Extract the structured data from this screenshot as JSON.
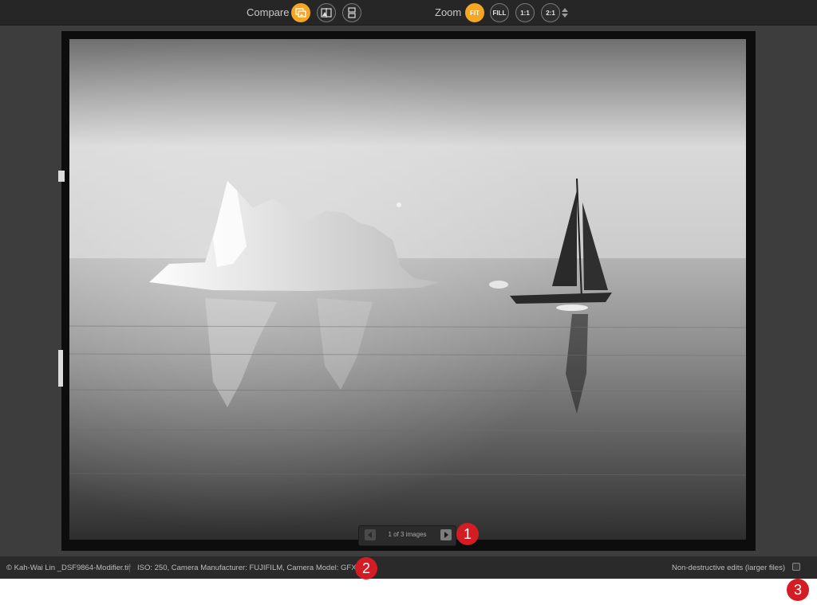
{
  "toolbar": {
    "compare_label": "Compare",
    "zoom_label": "Zoom",
    "compare_buttons": [
      {
        "icon": "compare-side-icon",
        "active": true
      },
      {
        "icon": "compare-split-icon",
        "active": false
      },
      {
        "icon": "compare-stack-icon",
        "active": false
      }
    ],
    "zoom_buttons": [
      {
        "label": "FIT",
        "active": true
      },
      {
        "label": "FILL",
        "active": false
      },
      {
        "label": "1:1",
        "active": false
      },
      {
        "label": "2:1",
        "active": false
      }
    ],
    "accent_color": "#f5a623"
  },
  "pager": {
    "text": "1 of 3 images",
    "prev_icon": "triangle-left-icon",
    "next_icon": "triangle-right-icon"
  },
  "status": {
    "file": "© Kah-Wai Lin _DSF9864-Modifier.tif",
    "meta": "ISO: 250, Camera Manufacturer: FUJIFILM, Camera Model: GFX 50R",
    "nondestructive_label": "Non-destructive edits (larger files)",
    "nondestructive_checked": false
  },
  "callouts": [
    "1",
    "2",
    "3"
  ],
  "colors": {
    "callout": "#d41c24",
    "toolbar_bg": "#262626",
    "canvas_bg": "#3d3d3d"
  }
}
